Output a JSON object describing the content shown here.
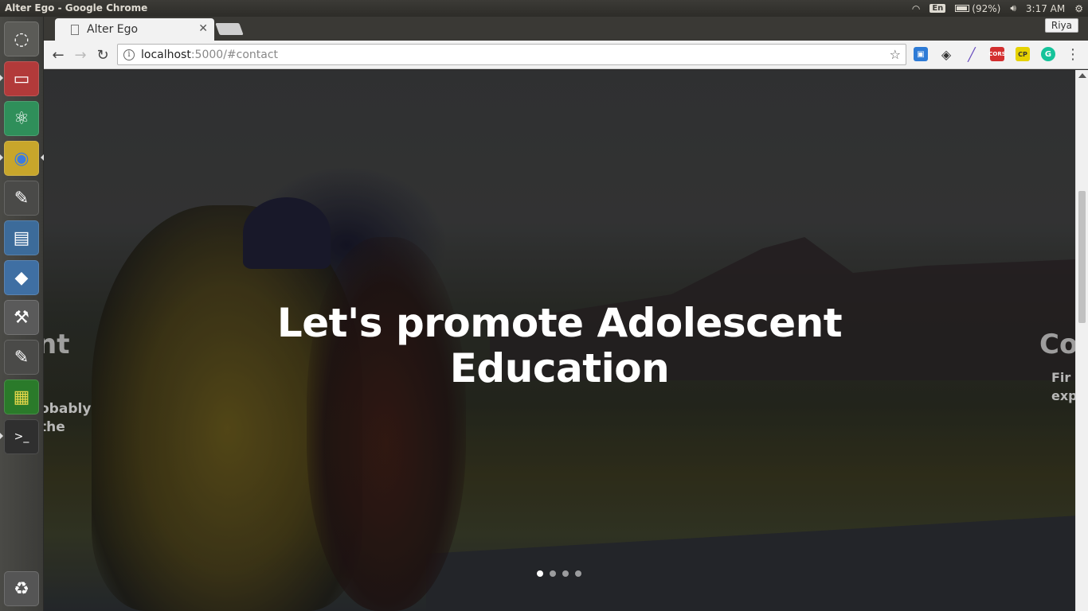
{
  "system_panel": {
    "window_title": "Alter Ego - Google Chrome",
    "keyboard_layout": "En",
    "battery": "(92%)",
    "time": "3:17 AM",
    "icons": [
      "wifi-icon",
      "keyboard-icon",
      "battery-icon",
      "volume-icon",
      "settings-gear-icon"
    ]
  },
  "launcher": {
    "items": [
      {
        "name": "ubuntu-dash-icon",
        "color": "#5b5b57"
      },
      {
        "name": "files-icon",
        "color": "#b23a3a"
      },
      {
        "name": "atom-editor-icon",
        "color": "#2f8f5a"
      },
      {
        "name": "chrome-icon",
        "color": "#c8a62b"
      },
      {
        "name": "text-editor-icon",
        "color": "#4a4a48"
      },
      {
        "name": "image-viewer-icon",
        "color": "#3c6b9a"
      },
      {
        "name": "virtualbox-icon",
        "color": "#3f6fa3"
      },
      {
        "name": "system-tools-icon",
        "color": "#5a5a5a"
      },
      {
        "name": "text-editor-2-icon",
        "color": "#4a4a48"
      },
      {
        "name": "puzzle-game-icon",
        "color": "#2a7a2a"
      },
      {
        "name": "terminal-icon",
        "color": "#2f2f2f"
      },
      {
        "name": "trash-icon",
        "color": "#555"
      }
    ]
  },
  "browser": {
    "tab_title": "Alter Ego",
    "profile_name": "Riya",
    "url_host": "localhost",
    "url_rest": ":5000/#contact",
    "extensions": [
      {
        "name": "extension-window-icon",
        "label": "",
        "color": "#2e7bd6"
      },
      {
        "name": "extension-diamond-icon",
        "label": "",
        "color": "#333"
      },
      {
        "name": "extension-eyedropper-icon",
        "label": "",
        "color": "#6a4fbf"
      },
      {
        "name": "extension-cors-icon",
        "label": "CORS",
        "color": "#d32f2f"
      },
      {
        "name": "extension-cp-icon",
        "label": "CP",
        "color": "#e6d200"
      },
      {
        "name": "extension-grammarly-icon",
        "label": "G",
        "color": "#15c39a"
      }
    ]
  },
  "hero": {
    "title": "Let's promote Adolescent Education",
    "left_peek_title": "nt",
    "left_peek_text_1": "obably",
    "left_peek_text_2": "the",
    "right_peek_title": "Co",
    "right_peek_text_1": "Fir",
    "right_peek_text_2": "exp",
    "slides_total": 4,
    "active_slide": 1
  }
}
